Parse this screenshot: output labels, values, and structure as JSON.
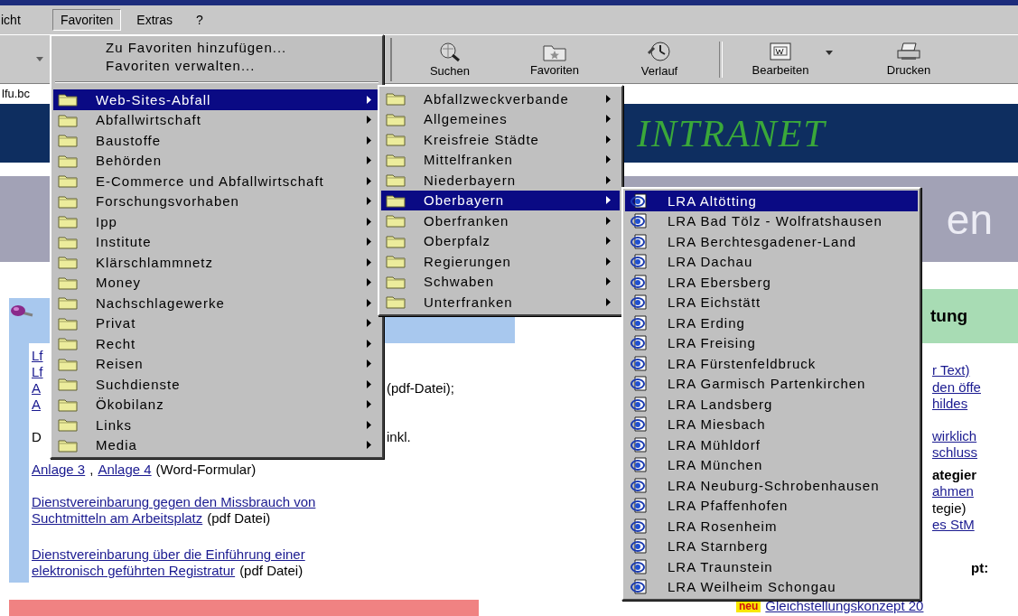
{
  "menu_bar": [
    {
      "label": "icht",
      "selected": false
    },
    {
      "label": "Favoriten",
      "selected": true
    },
    {
      "label": "Extras",
      "selected": false
    },
    {
      "label": "?",
      "selected": false
    }
  ],
  "toolbar": [
    {
      "kind": "search",
      "label": "Suchen"
    },
    {
      "kind": "favorites",
      "label": "Favoriten"
    },
    {
      "kind": "history",
      "label": "Verlauf"
    },
    {
      "kind": "separator"
    },
    {
      "kind": "edit",
      "label": "Bearbeiten"
    },
    {
      "kind": "dropdown"
    },
    {
      "kind": "print",
      "label": "Drucken"
    }
  ],
  "address": {
    "value": "lfu.bc"
  },
  "page": {
    "banner_title": "INTRANET",
    "band_text": "en",
    "left_column": {
      "paragraphs": [
        [
          {
            "segments": [
              {
                "kind": "link",
                "text": "Lf"
              }
            ]
          },
          {
            "segments": [
              {
                "kind": "link",
                "text": "Lf"
              }
            ]
          },
          {
            "segments": [
              {
                "kind": "link",
                "text": "A"
              }
            ],
            "aside": "(pdf-Datei);"
          },
          {
            "segments": [
              {
                "kind": "link",
                "text": "A"
              }
            ]
          }
        ],
        [
          {
            "segments": [
              {
                "kind": "text",
                "text": "D"
              }
            ],
            "aside": "inkl."
          }
        ],
        [
          {
            "segments": [
              {
                "kind": "link",
                "text": "Anlage 3"
              },
              {
                "kind": "text",
                "text": ","
              },
              {
                "kind": "link",
                "text": "Anlage 4"
              },
              {
                "kind": "text",
                "text": "(Word-Formular)"
              }
            ]
          }
        ],
        [
          {
            "segments": [
              {
                "kind": "link",
                "text": "Dienstvereinbarung gegen den Missbrauch von"
              }
            ]
          },
          {
            "segments": [
              {
                "kind": "link",
                "text": "Suchtmitteln am Arbeitsplatz"
              },
              {
                "kind": "text",
                "text": "(pdf Datei)"
              }
            ]
          }
        ],
        [
          {
            "segments": [
              {
                "kind": "link",
                "text": "Dienstvereinbarung über die Einführung einer"
              }
            ]
          },
          {
            "segments": [
              {
                "kind": "link",
                "text": "elektronisch geführten Registratur"
              },
              {
                "kind": "text",
                "text": "(pdf Datei)"
              }
            ]
          }
        ]
      ]
    },
    "right_column": {
      "heading": "tung",
      "groups": [
        [
          {
            "kind": "link",
            "text": "r Text)"
          },
          {
            "kind": "link",
            "text": "den öffe"
          },
          {
            "kind": "link",
            "text": "hildes"
          }
        ],
        [
          {
            "kind": "link",
            "text": "wirklich"
          },
          {
            "kind": "link",
            "text": "schluss"
          }
        ],
        [
          {
            "kind": "heading",
            "text": "ategier"
          },
          {
            "kind": "link",
            "text": "ahmen"
          },
          {
            "kind": "text",
            "text": "tegie)"
          },
          {
            "kind": "link",
            "text": "es StM"
          }
        ],
        [
          {
            "kind": "heading",
            "text": "pt:"
          }
        ]
      ],
      "news": {
        "badge": "neu",
        "link": "Gleichstellungskonzept 20"
      }
    }
  },
  "favorites_menu": {
    "commands": [
      "Zu Favoriten hinzufügen...",
      "Favoriten verwalten..."
    ],
    "folders": [
      {
        "label": "Web-Sites-Abfall",
        "selected": true,
        "children": [
          {
            "label": "Abfallzweckverbande",
            "selected": false
          },
          {
            "label": "Allgemeines",
            "selected": false
          },
          {
            "label": "Kreisfreie Städte",
            "selected": false
          },
          {
            "label": "Mittelfranken",
            "selected": false
          },
          {
            "label": "Niederbayern",
            "selected": false
          },
          {
            "label": "Oberbayern",
            "selected": true,
            "children": [
              {
                "label": "LRA Altötting",
                "selected": true
              },
              {
                "label": "LRA Bad Tölz - Wolfratshausen",
                "selected": false
              },
              {
                "label": "LRA Berchtesgadener-Land",
                "selected": false
              },
              {
                "label": "LRA Dachau",
                "selected": false
              },
              {
                "label": "LRA Ebersberg",
                "selected": false
              },
              {
                "label": "LRA Eichstätt",
                "selected": false
              },
              {
                "label": "LRA Erding",
                "selected": false
              },
              {
                "label": "LRA Freising",
                "selected": false
              },
              {
                "label": "LRA Fürstenfeldbruck",
                "selected": false
              },
              {
                "label": "LRA Garmisch Partenkirchen",
                "selected": false
              },
              {
                "label": "LRA Landsberg",
                "selected": false
              },
              {
                "label": "LRA Miesbach",
                "selected": false
              },
              {
                "label": "LRA Mühldorf",
                "selected": false
              },
              {
                "label": "LRA München",
                "selected": false
              },
              {
                "label": "LRA Neuburg-Schrobenhausen",
                "selected": false
              },
              {
                "label": "LRA Pfaffenhofen",
                "selected": false
              },
              {
                "label": "LRA Rosenheim",
                "selected": false
              },
              {
                "label": "LRA Starnberg",
                "selected": false
              },
              {
                "label": "LRA Traunstein",
                "selected": false
              },
              {
                "label": "LRA Weilheim Schongau",
                "selected": false
              }
            ]
          },
          {
            "label": "Oberfranken",
            "selected": false
          },
          {
            "label": "Oberpfalz",
            "selected": false
          },
          {
            "label": "Regierungen",
            "selected": false
          },
          {
            "label": "Schwaben",
            "selected": false
          },
          {
            "label": "Unterfranken",
            "selected": false
          }
        ]
      },
      {
        "label": "Abfallwirtschaft",
        "selected": false
      },
      {
        "label": "Baustoffe",
        "selected": false
      },
      {
        "label": "Behörden",
        "selected": false
      },
      {
        "label": "E-Commerce und Abfallwirtschaft",
        "selected": false
      },
      {
        "label": "Forschungsvorhaben",
        "selected": false
      },
      {
        "label": "Ipp",
        "selected": false
      },
      {
        "label": "Institute",
        "selected": false
      },
      {
        "label": "Klärschlammnetz",
        "selected": false
      },
      {
        "label": "Money",
        "selected": false
      },
      {
        "label": "Nachschlagewerke",
        "selected": false
      },
      {
        "label": "Privat",
        "selected": false
      },
      {
        "label": "Recht",
        "selected": false
      },
      {
        "label": "Reisen",
        "selected": false
      },
      {
        "label": "Suchdienste",
        "selected": false
      },
      {
        "label": "Ökobilanz",
        "selected": false
      },
      {
        "label": "Links",
        "selected": false
      },
      {
        "label": "Media",
        "selected": false
      }
    ]
  }
}
